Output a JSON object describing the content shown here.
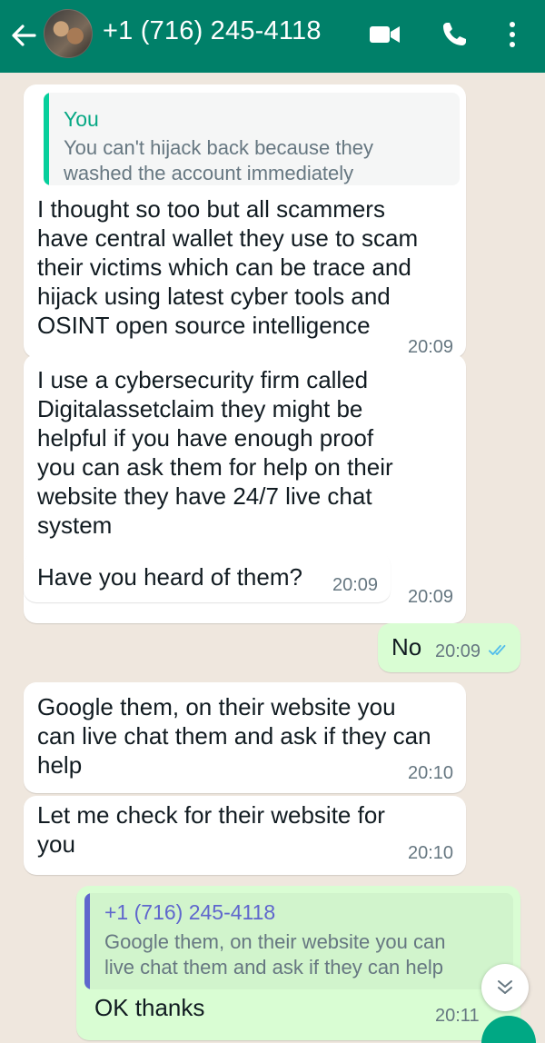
{
  "header": {
    "contact_name": "+1 (716) 245-4118"
  },
  "messages": [
    {
      "direction": "incoming",
      "quote": {
        "author": "You",
        "text": "You can't hijack back because they\nwashed the account immediately"
      },
      "text": "I thought so too but all scammers\nhave central wallet they use to scam\ntheir victims which can be trace and\nhijack using latest cyber tools and\nOSINT open source intelligence",
      "time": "20:09"
    },
    {
      "direction": "incoming",
      "text": "I use a cybersecurity firm called\nDigitalassetclaim they might be\nhelpful if you have enough proof\nyou can ask them for help on their\nwebsite they have 24/7 live chat\nsystem",
      "time": "20:09"
    },
    {
      "direction": "incoming",
      "text": "Have you heard of them?",
      "time": "20:09"
    },
    {
      "direction": "outgoing",
      "text": "No",
      "time": "20:09",
      "status": "read"
    },
    {
      "direction": "incoming",
      "text": "Google them, on their website you\ncan live chat them and ask if they can\nhelp",
      "time": "20:10"
    },
    {
      "direction": "incoming",
      "text": "Let me check for their website for\nyou",
      "time": "20:10"
    },
    {
      "direction": "outgoing",
      "quote": {
        "author": "+1 (716) 245-4118",
        "text": "Google them, on their website you can\nlive chat them and ask if they can help"
      },
      "text": "OK thanks",
      "time": "20:11"
    }
  ],
  "icons": {
    "back": "arrow-left",
    "video": "video-camera",
    "call": "phone",
    "menu": "vertical-dots",
    "read_receipt": "double-check",
    "scroll_down": "double-chevron-down"
  },
  "colors": {
    "header": "#008069",
    "chat_background": "#efe7de",
    "incoming_bubble": "#ffffff",
    "outgoing_bubble": "#d9fdd3",
    "read_tick": "#53bdeb"
  }
}
